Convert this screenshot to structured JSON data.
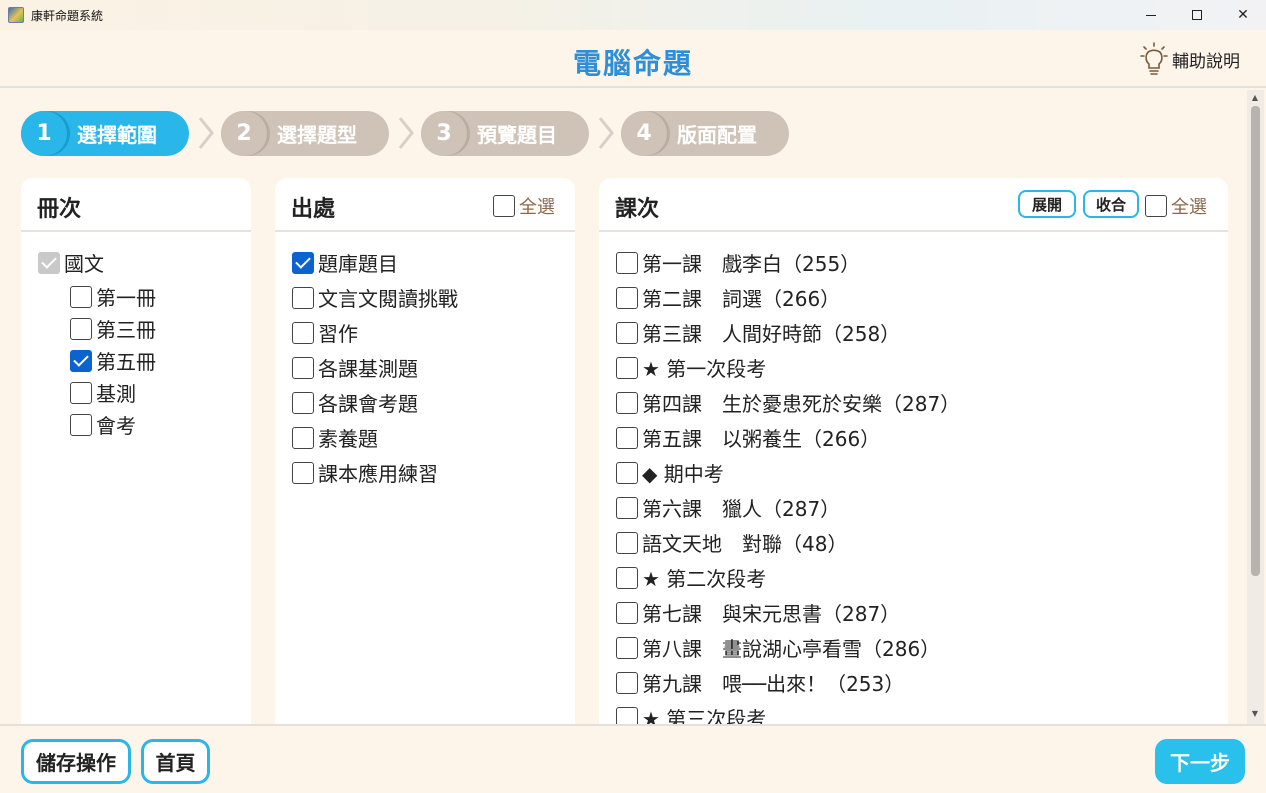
{
  "window": {
    "title": "康軒命題系統",
    "minimize_icon": "minimize-icon",
    "maximize_icon": "maximize-icon",
    "close_label": "✕"
  },
  "header": {
    "title": "電腦命題",
    "help_label": "輔助說明",
    "help_icon": "lightbulb-icon"
  },
  "steps": [
    {
      "num": "1",
      "label": "選擇範圍",
      "active": true
    },
    {
      "num": "2",
      "label": "選擇題型",
      "active": false
    },
    {
      "num": "3",
      "label": "預覽題目",
      "active": false
    },
    {
      "num": "4",
      "label": "版面配置",
      "active": false
    }
  ],
  "volumes": {
    "title": "冊次",
    "root": {
      "label": "國文",
      "state": "checked-disabled"
    },
    "items": [
      {
        "label": "第一冊",
        "checked": false
      },
      {
        "label": "第三冊",
        "checked": false
      },
      {
        "label": "第五冊",
        "checked": true
      },
      {
        "label": "基測",
        "checked": false
      },
      {
        "label": "會考",
        "checked": false
      }
    ]
  },
  "sources": {
    "title": "出處",
    "select_all_label": "全選",
    "items": [
      {
        "label": "題庫題目",
        "checked": true
      },
      {
        "label": "文言文閱讀挑戰",
        "checked": false
      },
      {
        "label": "習作",
        "checked": false
      },
      {
        "label": "各課基測題",
        "checked": false
      },
      {
        "label": "各課會考題",
        "checked": false
      },
      {
        "label": "素養題",
        "checked": false
      },
      {
        "label": "課本應用練習",
        "checked": false
      }
    ]
  },
  "lessons": {
    "title": "課次",
    "expand_label": "展開",
    "collapse_label": "收合",
    "select_all_label": "全選",
    "items": [
      {
        "label": "第一課　戲李白（255）",
        "checked": false
      },
      {
        "label": "第二課　詞選（266）",
        "checked": false
      },
      {
        "label": "第三課　人間好時節（258）",
        "checked": false
      },
      {
        "label": "★ 第一次段考",
        "checked": false
      },
      {
        "label": "第四課　生於憂患死於安樂（287）",
        "checked": false
      },
      {
        "label": "第五課　以粥養生（266）",
        "checked": false
      },
      {
        "label": "◆ 期中考",
        "checked": false
      },
      {
        "label": "第六課　獵人（287）",
        "checked": false
      },
      {
        "label": "語文天地　對聯（48）",
        "checked": false
      },
      {
        "label": "★ 第二次段考",
        "checked": false
      },
      {
        "label": "第七課　與宋元思書（287）",
        "checked": false
      },
      {
        "label": "第八課　畫說湖心亭看雪（286）",
        "checked": false
      },
      {
        "label": "第九課　喂──出來！（253）",
        "checked": false
      },
      {
        "label": "★ 第三次段考",
        "checked": false
      }
    ]
  },
  "footer": {
    "save_label": "儲存操作",
    "home_label": "首頁",
    "next_label": "下一步"
  },
  "colors": {
    "accent": "#29b6e8",
    "title_blue": "#2f8fd6",
    "step_idle": "#cfc3b8",
    "background": "#fdf4ea",
    "check_blue": "#0b63cf"
  }
}
